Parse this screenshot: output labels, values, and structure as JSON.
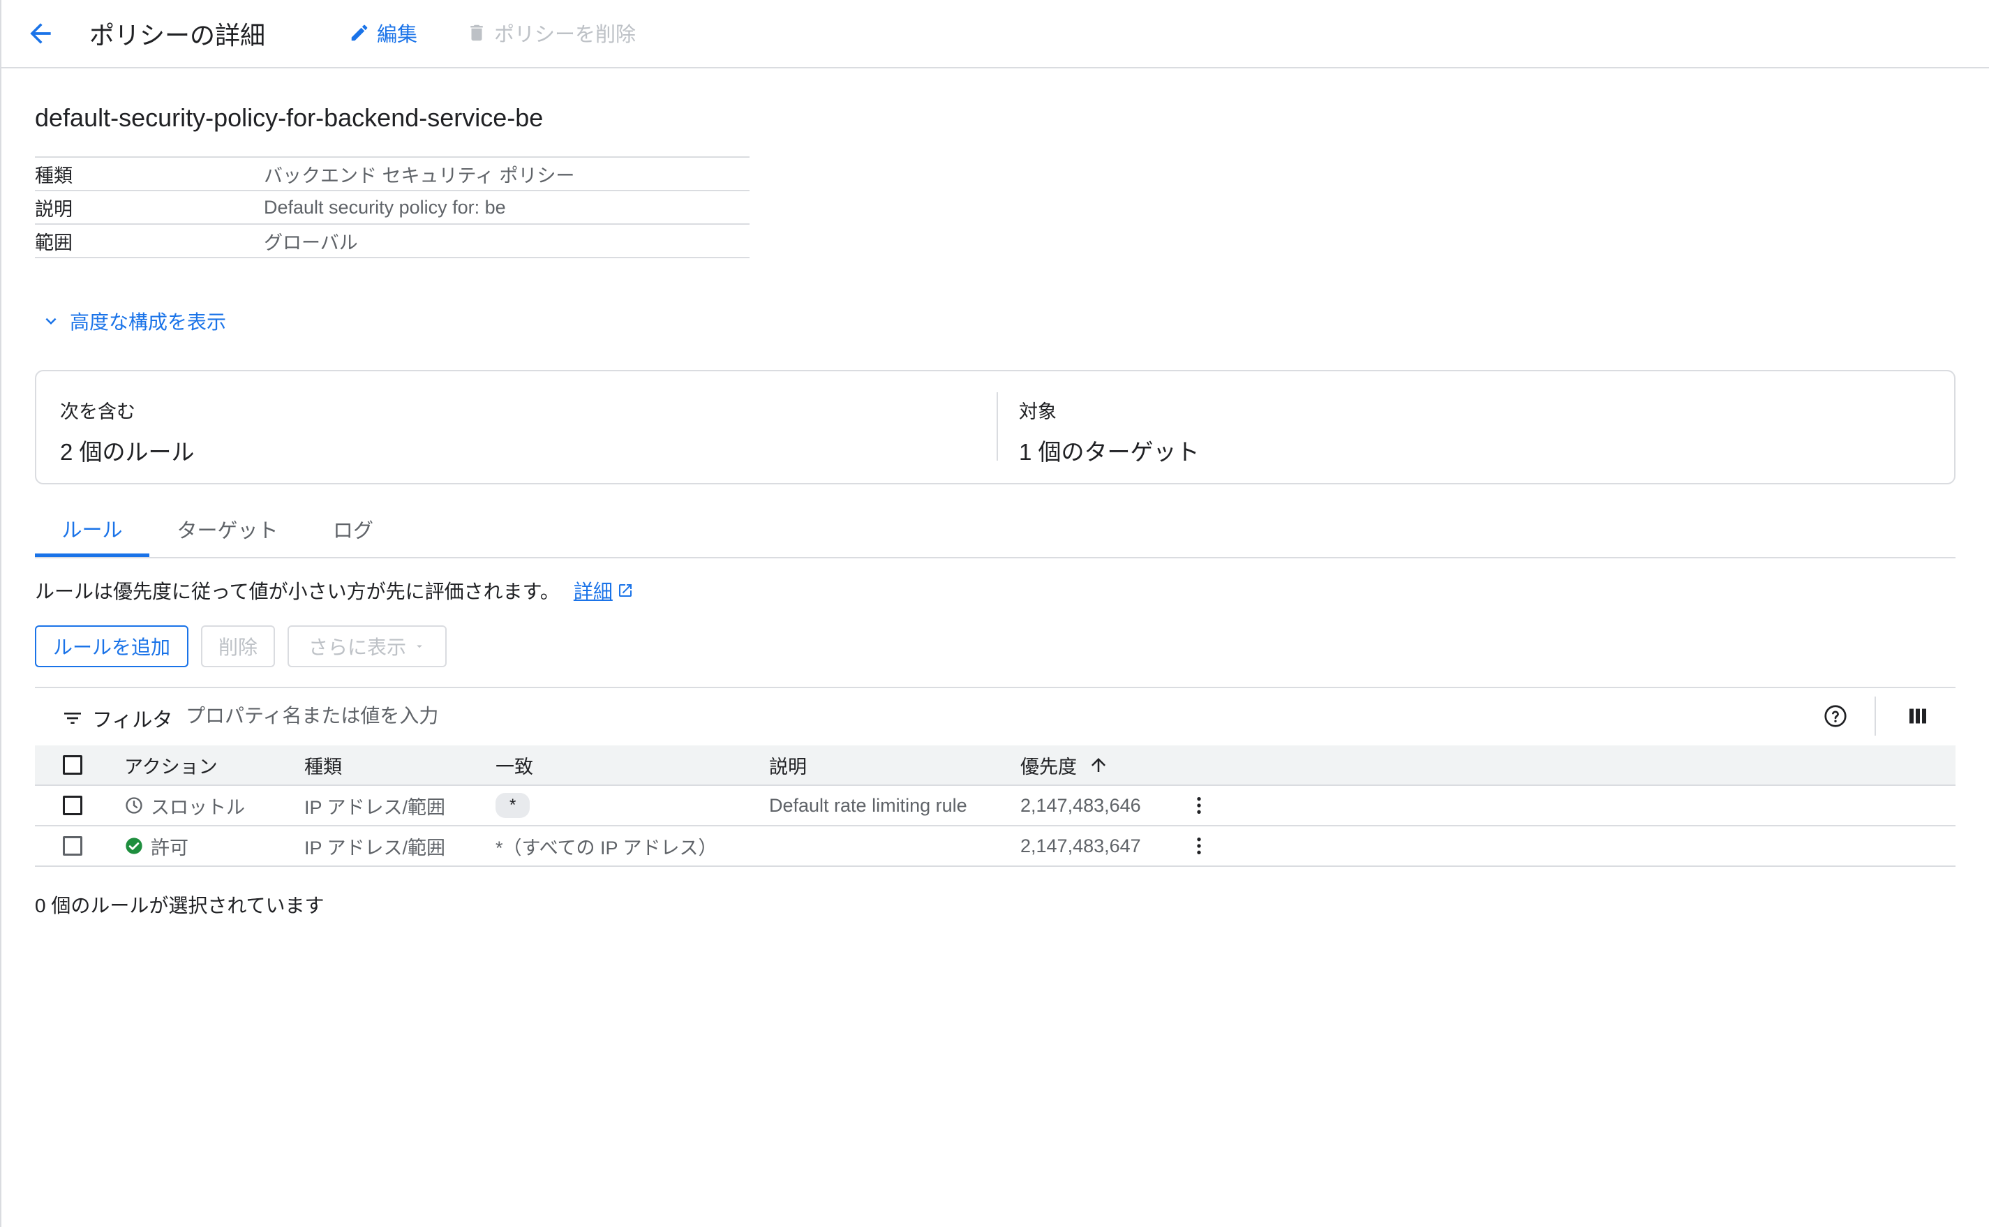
{
  "header": {
    "title": "ポリシーの詳細",
    "edit_label": "編集",
    "delete_label": "ポリシーを削除"
  },
  "policy": {
    "name": "default-security-policy-for-backend-service-be",
    "fields": [
      {
        "key": "種類",
        "value": "バックエンド セキュリティ ポリシー"
      },
      {
        "key": "説明",
        "value": "Default security policy for: be"
      },
      {
        "key": "範囲",
        "value": "グローバル"
      }
    ]
  },
  "advanced_toggle": "高度な構成を表示",
  "summary": {
    "contains_label": "次を含む",
    "contains_value": "2 個のルール",
    "target_label": "対象",
    "target_value": "1 個のターゲット"
  },
  "tabs": [
    "ルール",
    "ターゲット",
    "ログ"
  ],
  "active_tab": "ルール",
  "info": {
    "text": "ルールは優先度に従って値が小さい方が先に評価されます。",
    "link": "詳細"
  },
  "actions": {
    "add_rule": "ルールを追加",
    "delete": "削除",
    "more": "さらに表示"
  },
  "filter": {
    "label": "フィルタ",
    "placeholder": "プロパティ名または値を入力"
  },
  "table": {
    "columns": [
      "アクション",
      "種類",
      "一致",
      "説明",
      "優先度"
    ],
    "sort_column": "優先度",
    "sort_direction": "ascending",
    "rows": [
      {
        "action": "スロットル",
        "action_icon": "clock-icon",
        "type": "IP アドレス/範囲",
        "match": "*",
        "match_chip": true,
        "description": "Default rate limiting rule",
        "priority": "2,147,483,646"
      },
      {
        "action": "許可",
        "action_icon": "check-circle-icon",
        "type": "IP アドレス/範囲",
        "match": "*（すべての IP アドレス）",
        "match_chip": false,
        "description": "",
        "priority": "2,147,483,647"
      }
    ]
  },
  "selection_status": "0 個のルールが選択されています",
  "colors": {
    "accent": "#1a73e8",
    "allow_green": "#1e8e3e",
    "disabled": "#bdc1c6",
    "border": "#dadce0"
  }
}
